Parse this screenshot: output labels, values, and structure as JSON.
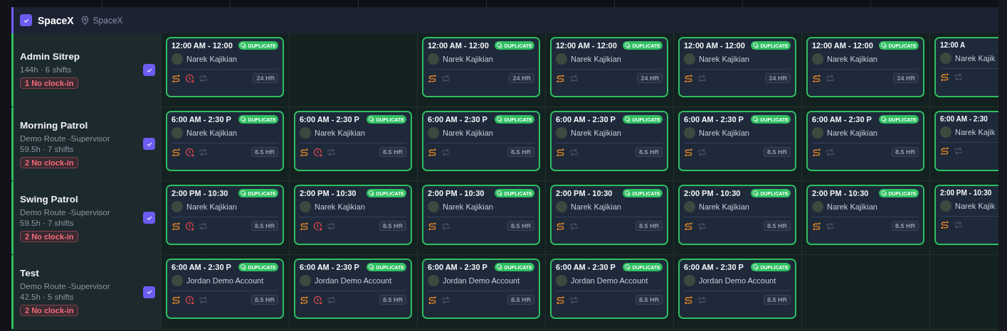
{
  "group": {
    "name": "SpaceX",
    "checked": true,
    "location": "SpaceX"
  },
  "rows": [
    {
      "title": "Admin Sitrep",
      "stats": "144h · 6 shifts",
      "alert": "1 No clock-in",
      "checked": true,
      "cells": [
        {
          "kind": "shift",
          "time": "12:00 AM - 12:00",
          "badge": "DUPLICATE",
          "name": "Narek Kajikian",
          "no_clock_in": true,
          "hours": "24 HR"
        },
        {
          "kind": "empty"
        },
        {
          "kind": "shift",
          "time": "12:00 AM - 12:00",
          "badge": "DUPLICATE",
          "name": "Narek Kajikian",
          "no_clock_in": false,
          "hours": "24 HR"
        },
        {
          "kind": "shift",
          "time": "12:00 AM - 12:00",
          "badge": "DUPLICATE",
          "name": "Narek Kajikian",
          "no_clock_in": false,
          "hours": "24 HR"
        },
        {
          "kind": "shift",
          "time": "12:00 AM - 12:00",
          "badge": "DUPLICATE",
          "name": "Narek Kajikian",
          "no_clock_in": false,
          "hours": "24 HR"
        },
        {
          "kind": "shift",
          "time": "12:00 AM - 12:00",
          "badge": "DUPLICATE",
          "name": "Narek Kajikian",
          "no_clock_in": false,
          "hours": "24 HR"
        },
        {
          "kind": "clipped",
          "time": "12:00 A",
          "name": "Narek Kajik",
          "no_clock_in": false
        }
      ]
    },
    {
      "title": "Morning Patrol",
      "subtitle": "Demo Route -Supervisor",
      "stats": "59.5h · 7 shifts",
      "alert": "2 No clock-in",
      "checked": true,
      "cells": [
        {
          "kind": "shift",
          "time": "6:00 AM - 2:30 P",
          "badge": "DUPLICATE",
          "name": "Narek Kajikian",
          "no_clock_in": true,
          "hours": "8.5 HR"
        },
        {
          "kind": "shift",
          "time": "6:00 AM - 2:30 P",
          "badge": "DUPLICATE",
          "name": "Narek Kajikian",
          "no_clock_in": true,
          "hours": "8.5 HR"
        },
        {
          "kind": "shift",
          "time": "6:00 AM - 2:30 P",
          "badge": "DUPLICATE",
          "name": "Narek Kajikian",
          "no_clock_in": false,
          "hours": "8.5 HR"
        },
        {
          "kind": "shift",
          "time": "6:00 AM - 2:30 P",
          "badge": "DUPLICATE",
          "name": "Narek Kajikian",
          "no_clock_in": false,
          "hours": "8.5 HR"
        },
        {
          "kind": "shift",
          "time": "6:00 AM - 2:30 P",
          "badge": "DUPLICATE",
          "name": "Narek Kajikian",
          "no_clock_in": false,
          "hours": "8.5 HR"
        },
        {
          "kind": "shift",
          "time": "6:00 AM - 2:30 P",
          "badge": "DUPLICATE",
          "name": "Narek Kajikian",
          "no_clock_in": false,
          "hours": "8.5 HR"
        },
        {
          "kind": "clipped",
          "time": "6:00 AM - 2:30",
          "name": "Narek Kajik",
          "no_clock_in": false
        }
      ]
    },
    {
      "title": "Swing Patrol",
      "subtitle": "Demo Route -Supervisor",
      "stats": "59.5h · 7 shifts",
      "alert": "2 No clock-in",
      "checked": true,
      "cells": [
        {
          "kind": "shift",
          "time": "2:00 PM - 10:30",
          "badge": "DUPLICATE",
          "name": "Narek Kajikian",
          "no_clock_in": true,
          "hours": "8.5 HR"
        },
        {
          "kind": "shift",
          "time": "2:00 PM - 10:30",
          "badge": "DUPLICATE",
          "name": "Narek Kajikian",
          "no_clock_in": true,
          "hours": "8.5 HR"
        },
        {
          "kind": "shift",
          "time": "2:00 PM - 10:30",
          "badge": "DUPLICATE",
          "name": "Narek Kajikian",
          "no_clock_in": false,
          "hours": "8.5 HR"
        },
        {
          "kind": "shift",
          "time": "2:00 PM - 10:30",
          "badge": "DUPLICATE",
          "name": "Narek Kajikian",
          "no_clock_in": false,
          "hours": "8.5 HR"
        },
        {
          "kind": "shift",
          "time": "2:00 PM - 10:30",
          "badge": "DUPLICATE",
          "name": "Narek Kajikian",
          "no_clock_in": false,
          "hours": "8.5 HR"
        },
        {
          "kind": "shift",
          "time": "2:00 PM - 10:30",
          "badge": "DUPLICATE",
          "name": "Narek Kajikian",
          "no_clock_in": false,
          "hours": "8.5 HR"
        },
        {
          "kind": "clipped",
          "time": "2:00 PM - 10:30",
          "name": "Narek Kajik",
          "no_clock_in": false
        }
      ]
    },
    {
      "title": "Test",
      "subtitle": "Demo Route -Supervisor",
      "stats": "42.5h · 5 shifts",
      "alert": "2 No clock-in",
      "checked": true,
      "cells": [
        {
          "kind": "shift",
          "time": "6:00 AM - 2:30 P",
          "badge": "DUPLICATE",
          "name": "Jordan Demo Account",
          "no_clock_in": true,
          "hours": "8.5 HR"
        },
        {
          "kind": "shift",
          "time": "6:00 AM - 2:30 P",
          "badge": "DUPLICATE",
          "name": "Jordan Demo Account",
          "no_clock_in": true,
          "hours": "8.5 HR"
        },
        {
          "kind": "shift",
          "time": "6:00 AM - 2:30 P",
          "badge": "DUPLICATE",
          "name": "Jordan Demo Account",
          "no_clock_in": false,
          "hours": "8.5 HR"
        },
        {
          "kind": "shift",
          "time": "6:00 AM - 2:30 P",
          "badge": "DUPLICATE",
          "name": "Jordan Demo Account",
          "no_clock_in": false,
          "hours": "8.5 HR"
        },
        {
          "kind": "shift",
          "time": "6:00 AM - 2:30 P",
          "badge": "DUPLICATE",
          "name": "Jordan Demo Account",
          "no_clock_in": false,
          "hours": "8.5 HR"
        },
        {
          "kind": "empty"
        },
        {
          "kind": "empty"
        }
      ]
    }
  ]
}
